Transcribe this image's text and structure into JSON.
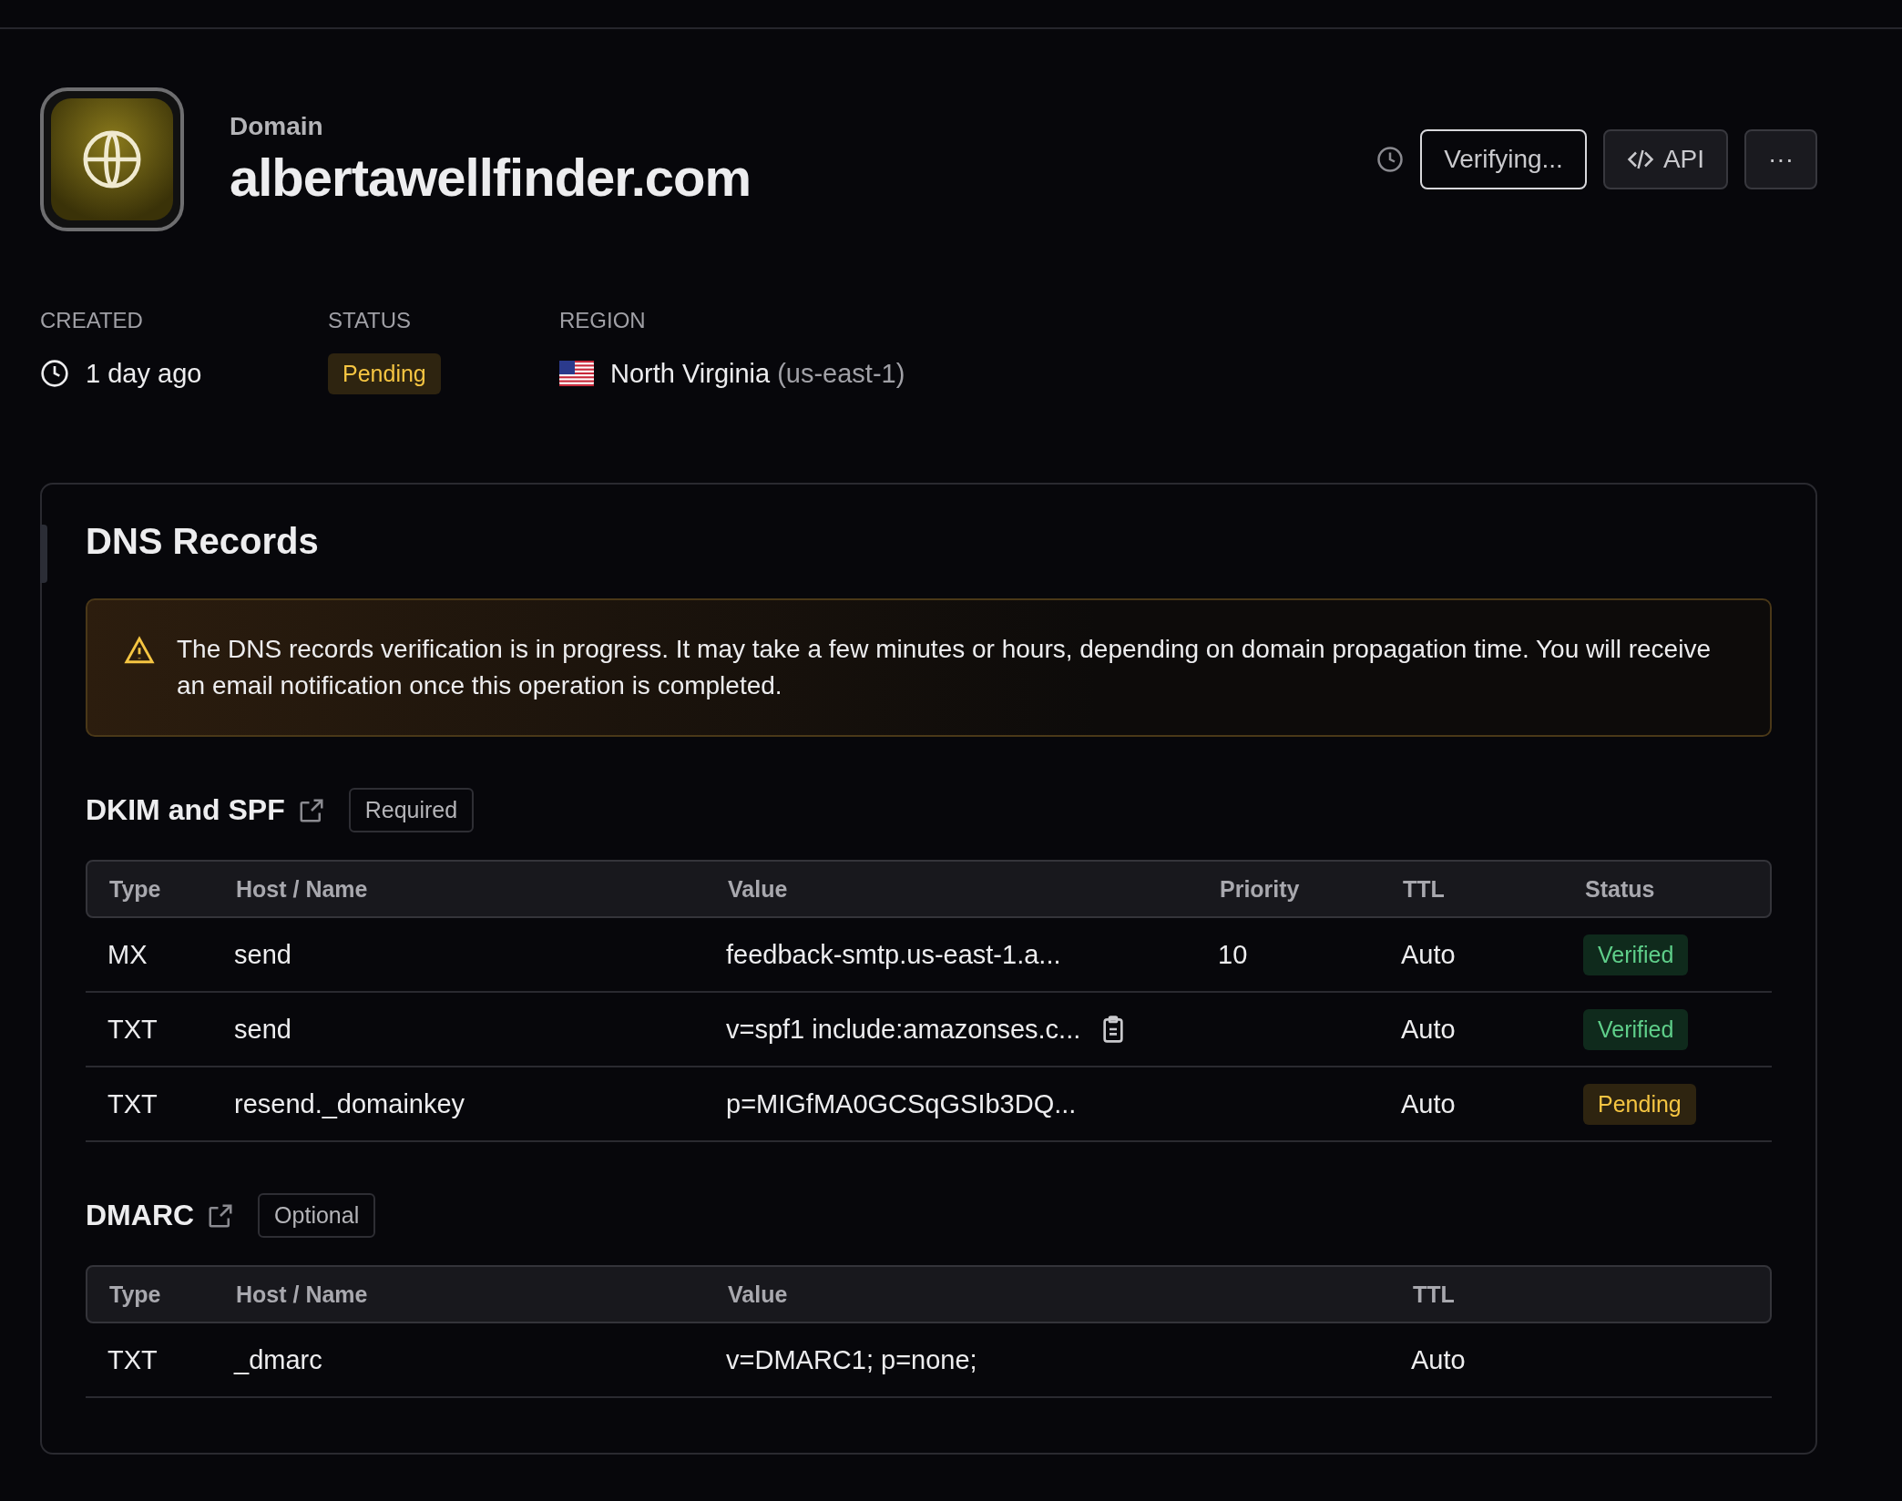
{
  "header": {
    "eyebrow": "Domain",
    "title": "albertawellfinder.com",
    "verify_button": "Verifying...",
    "api_button": "API",
    "more_button": "···"
  },
  "meta": [
    {
      "kind": "created",
      "label": "CREATED",
      "value": "1 day ago"
    },
    {
      "kind": "status",
      "label": "STATUS",
      "value": "Pending"
    },
    {
      "kind": "region",
      "label": "REGION",
      "value": "North Virginia",
      "detail": "(us-east-1)"
    }
  ],
  "dns": {
    "title": "DNS Records",
    "alert": "The DNS records verification is in progress. It may take a few minutes or hours, depending on domain propagation time. You will receive an email notification once this operation is completed.",
    "sections": [
      {
        "title": "DKIM and SPF",
        "badge": "Required",
        "columns": [
          "Type",
          "Host / Name",
          "Value",
          "Priority",
          "TTL",
          "Status"
        ],
        "rows": [
          {
            "type": "MX",
            "host": "send",
            "value": "feedback-smtp.us-east-1.a...",
            "copyable": false,
            "priority": "10",
            "ttl": "Auto",
            "status": {
              "label": "Verified",
              "kind": "verified"
            }
          },
          {
            "type": "TXT",
            "host": "send",
            "value": "v=spf1 include:amazonses.c...",
            "copyable": true,
            "ttl": "Auto",
            "status": {
              "label": "Verified",
              "kind": "verified"
            }
          },
          {
            "type": "TXT",
            "host": "resend._domainkey",
            "value": "p=MIGfMA0GCSqGSIb3DQ...",
            "copyable": false,
            "ttl": "Auto",
            "status": {
              "label": "Pending",
              "kind": "pending"
            }
          }
        ]
      },
      {
        "title": "DMARC",
        "badge": "Optional",
        "columns": [
          "Type",
          "Host / Name",
          "Value",
          "TTL"
        ],
        "rows": [
          {
            "type": "TXT",
            "host": "_dmarc",
            "value": "v=DMARC1; p=none;",
            "copyable": false,
            "ttl": "Auto"
          }
        ]
      }
    ]
  }
}
